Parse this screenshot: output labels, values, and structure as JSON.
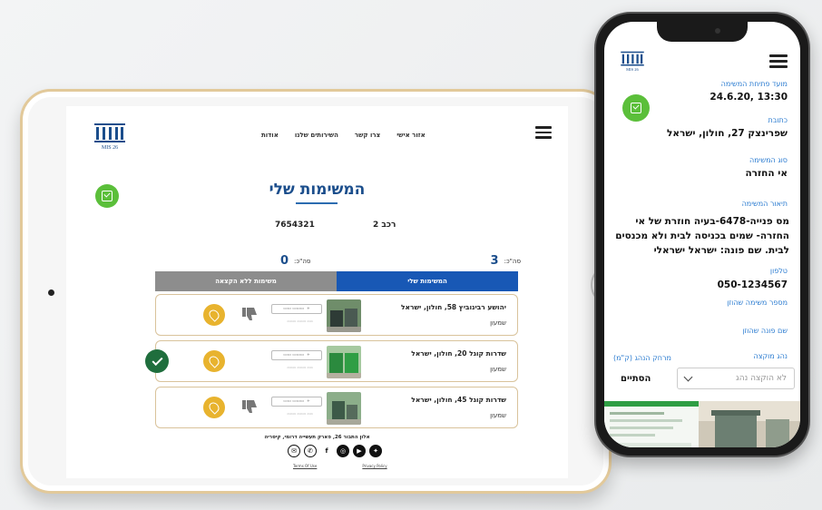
{
  "tablet": {
    "nav": [
      "אזור אישי",
      "צרו קשר",
      "השירותים שלנו",
      "אודות"
    ],
    "title": "המשימות שלי",
    "vehicle_label": "רכב 2",
    "vehicle_number": "7654321",
    "count_right_label": "סה\"כ:",
    "count_right_value": "3",
    "count_left_label": "סה\"כ:",
    "count_left_value": "0",
    "tab_active": "המשימות שלי",
    "tab_inactive": "משימות ללא הקצאה",
    "tasks": [
      {
        "address": "יהושע רבינוביץ 58, חולון, ישראל",
        "kind": "שמעון",
        "done": false
      },
      {
        "address": "שדרות קוגל 20, חולון, ישראל",
        "kind": "שמעון",
        "done": true
      },
      {
        "address": "שדרות קוגל 45, חולון, ישראל",
        "kind": "שמעון",
        "done": false
      }
    ],
    "footer_address": "אלון התבור 26, פארק תעשייה דרומי, קיסריה",
    "terms": "Terms Of Use",
    "privacy": "Privacy Policy"
  },
  "phone": {
    "open_time_label": "מועד פתיחת המשימה",
    "open_time_value": "24.6.20, 13:30",
    "address_label": "כתובת",
    "address_value": "שפרינצק 27, חולון, ישראל",
    "type_label": "סוג המשימה",
    "type_value": "אי החזרה",
    "desc_label": "תיאור המשימה",
    "desc_value": "מס פנייה-6478-בעיה חוזרת של אי החזרה- שמים בכניסה לבית ולא מכנסים לבית. שם פונה: ישראל ישראלי",
    "phone_label": "טלפון",
    "phone_value": "050-1234567",
    "task_no_label": "מספר משימה שהוזן",
    "name_label": "שם פונה שהוזן",
    "driver_label": "נהג מוקצה",
    "distance_label": "מרחק הנהג (ק\"מ)",
    "select_placeholder": "לא הוקצה נהג",
    "close_label": "הסתיים"
  },
  "colors": {
    "primary": "#1858b5",
    "accent_green": "#5bbf3a",
    "pin": "#e8b32e",
    "done": "#1f6e3d"
  }
}
